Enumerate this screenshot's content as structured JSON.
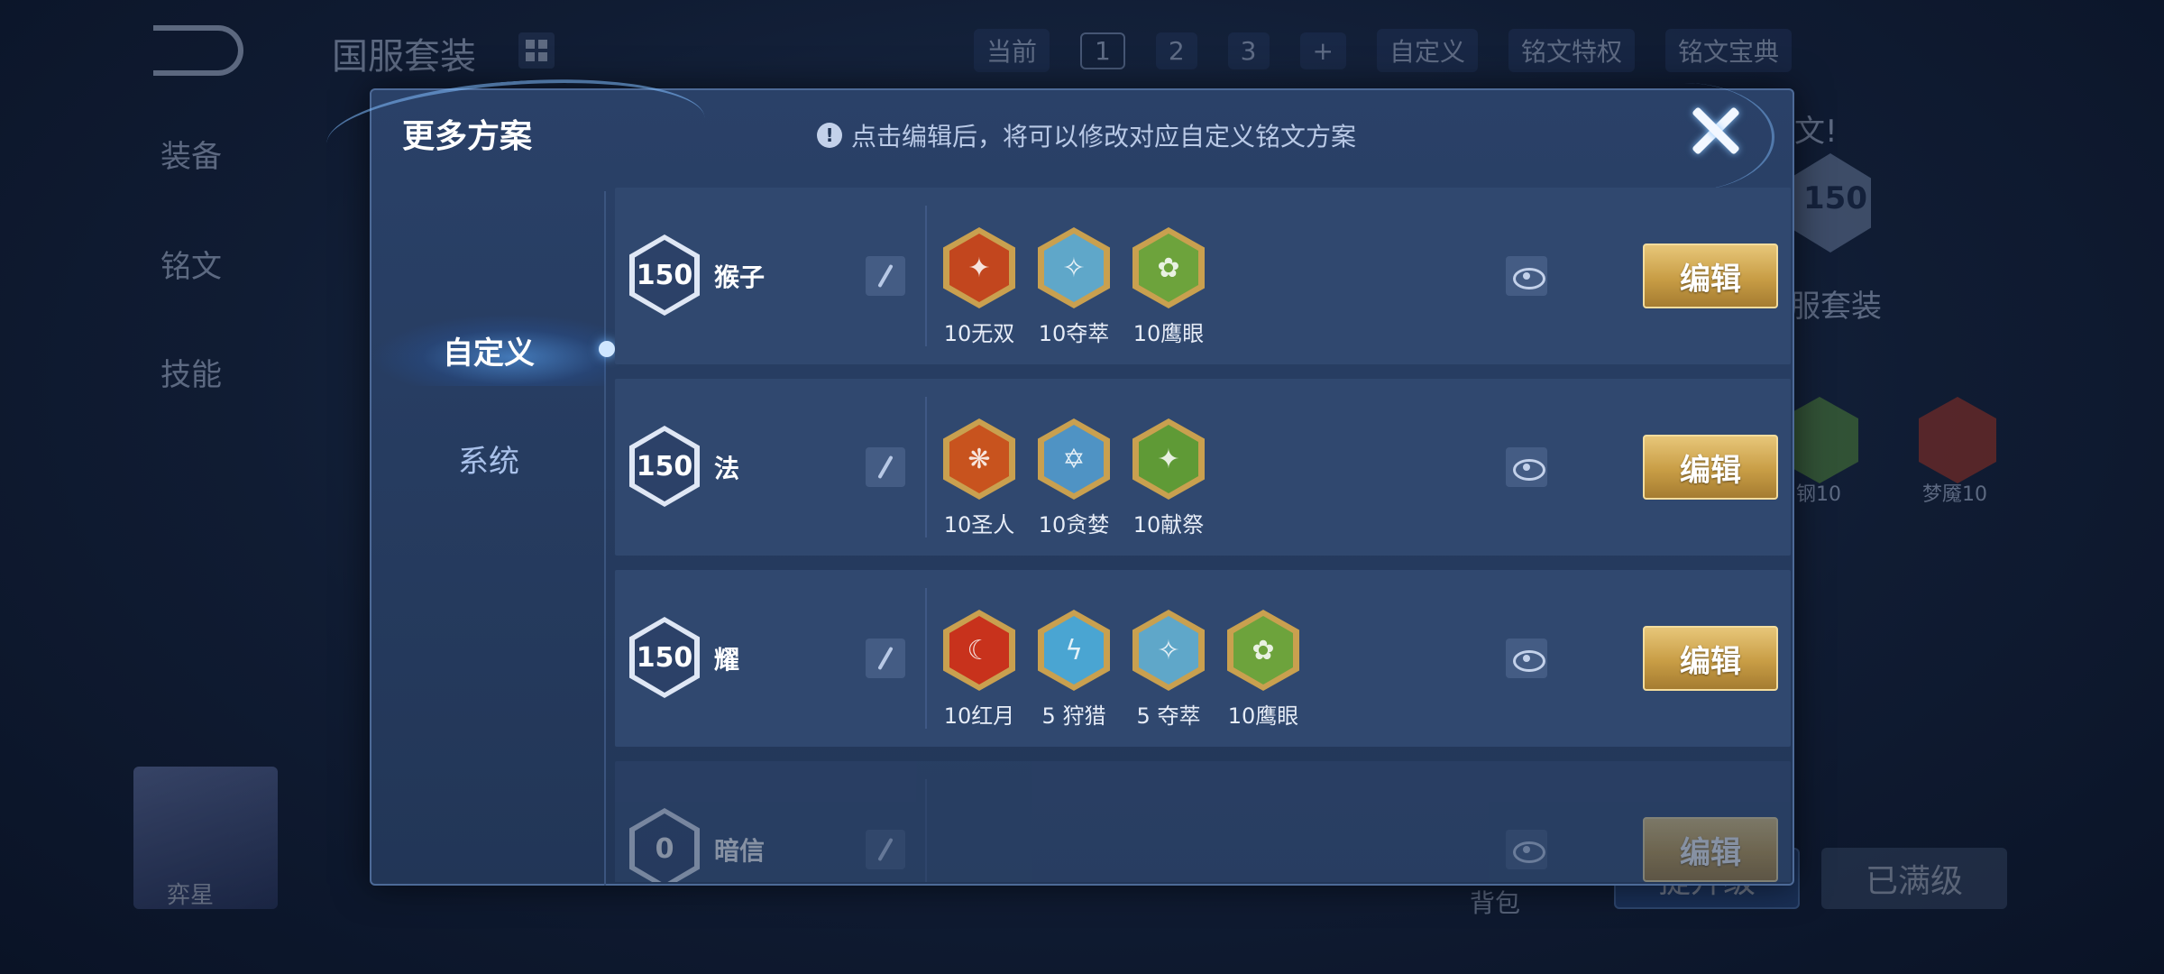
{
  "background": {
    "title": "国服套装",
    "nav": {
      "current_label": "当前",
      "pages": [
        "1",
        "2",
        "3"
      ],
      "add": "+",
      "custom": "自定义",
      "privilege": "铭文特权",
      "guide": "铭文宝典"
    },
    "side": [
      "装备",
      "铭文",
      "技能"
    ],
    "right_badge": "150",
    "right_text": "服套装",
    "right_partial": "文!",
    "gem_labels": [
      "钢10",
      "梦魇10"
    ],
    "hero_name": "弈星",
    "bag": "背包",
    "upgrade_button": "提升级",
    "maxed_button": "已满级"
  },
  "modal": {
    "title": "更多方案",
    "hint_icon": "!",
    "hint": "点击编辑后，将可以修改对应自定义铭文方案",
    "close_icon": "close-icon"
  },
  "tabs": [
    {
      "label": "自定义",
      "active": true
    },
    {
      "label": "系统",
      "active": false
    }
  ],
  "presets": [
    {
      "level": "150",
      "name": "猴子",
      "runes": [
        {
          "label": "10无双",
          "color": "#c2461e"
        },
        {
          "label": "10夺萃",
          "color": "#5fa7c9"
        },
        {
          "label": "10鹰眼",
          "color": "#6da33c"
        }
      ],
      "edit": "编辑"
    },
    {
      "level": "150",
      "name": "法",
      "runes": [
        {
          "label": "10圣人",
          "color": "#c8531e"
        },
        {
          "label": "10贪婪",
          "color": "#4f93c4"
        },
        {
          "label": "10献祭",
          "color": "#5f9a36"
        }
      ],
      "edit": "编辑"
    },
    {
      "level": "150",
      "name": "耀",
      "runes": [
        {
          "label": "10红月",
          "color": "#c8321c"
        },
        {
          "label": "5 狩猎",
          "color": "#4aa5d2"
        },
        {
          "label": "5 夺萃",
          "color": "#5fa7c9"
        },
        {
          "label": "10鹰眼",
          "color": "#6da33c"
        }
      ],
      "edit": "编辑"
    },
    {
      "level": "0",
      "name": "暗信",
      "runes": [],
      "edit": "编辑"
    }
  ]
}
